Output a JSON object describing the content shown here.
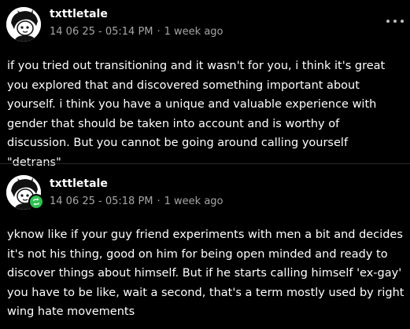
{
  "posts": [
    {
      "username": "txttletale",
      "date": "14 06 25 - 05:14 PM",
      "separator": "·",
      "relative_time": "1 week ago",
      "reposted": false,
      "text": "if you tried out transitioning and it wasn't for you, i think it's great you explored that and discovered something important about yourself. i think you have a unique and valuable experience with gender that should be taken into account and is worthy of discussion. But you cannot be going around calling yourself \"detrans\""
    },
    {
      "username": "txttletale",
      "date": "14 06 25 - 05:18 PM",
      "separator": "·",
      "relative_time": "1 week ago",
      "reposted": true,
      "text": "yknow like if your guy friend experiments with men a bit and decides it's not his thing, good on him for being open minded and ready to discover things about himself. But if he starts calling himself 'ex-gay' you have to be like, wait a second, that's a term mostly used by right wing hate movements"
    }
  ],
  "icons": {
    "more": "more-options-icon",
    "repost": "repost-icon",
    "avatar": "avatar"
  },
  "colors": {
    "background": "#000000",
    "text": "#ffffff",
    "meta": "#a6a6a6",
    "repost_badge": "#2fbf52"
  }
}
